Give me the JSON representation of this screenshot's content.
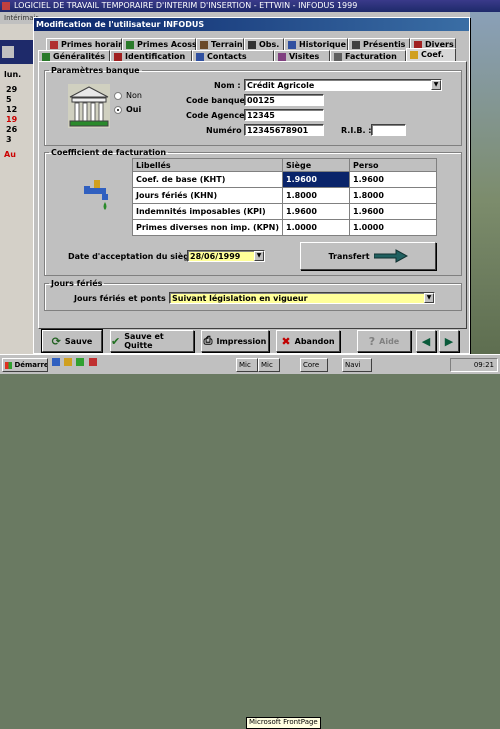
{
  "background_app": {
    "title": "LOGICIEL DE TRAVAIL TEMPORAIRE D'INTERIM D'INSERTION - ETTWIN - INFODUS 1999",
    "menu": "Intérimair",
    "calendar_header": "lun.",
    "calendar_days": [
      "29",
      "5",
      "12",
      "19",
      "26",
      "3"
    ],
    "calendar_footer": "Au"
  },
  "dialog": {
    "title": "Modification de l'utilisateur INFODUS",
    "tabs_row1": [
      "Primes horaires",
      "Primes Acoss",
      "Terrain",
      "Obs.",
      "Historique",
      "Présentis",
      "Divers"
    ],
    "tabs_row2": [
      "Généralités",
      "Identification",
      "Contacts",
      "Visites",
      "Facturation",
      "Coef."
    ],
    "active_tab": "Coef."
  },
  "banque": {
    "legend": "Paramètres banque",
    "radio_non": "Non",
    "radio_oui": "Oui",
    "nom_label": "Nom :",
    "nom_value": "Crédit Agricole",
    "code_banque_label": "Code banque :",
    "code_banque_value": "00125",
    "code_agence_label": "Code Agence :",
    "code_agence_value": "12345",
    "numero_label": "Numéro :",
    "numero_value": "12345678901",
    "rib_label": "R.I.B. :",
    "rib_value": ""
  },
  "facturation": {
    "legend": "Coefficient de facturation",
    "headers": [
      "Libellés",
      "Siège",
      "Perso"
    ],
    "rows": [
      {
        "label": "Coef. de base (KHT)",
        "siege": "1.9600",
        "perso": "1.9600"
      },
      {
        "label": "Jours fériés (KHN)",
        "siege": "1.8000",
        "perso": "1.8000"
      },
      {
        "label": "Indemnités imposables (KPI)",
        "siege": "1.9600",
        "perso": "1.9600"
      },
      {
        "label": "Primes diverses non imp. (KPN)",
        "siege": "1.0000",
        "perso": "1.0000"
      }
    ],
    "date_label": "Date d'acceptation du siège :",
    "date_value": "28/06/1999",
    "transfert_label": "Transfert"
  },
  "feries": {
    "legend": "Jours fériés",
    "label": "Jours fériés et ponts :",
    "value": "Suivant législation en vigueur"
  },
  "buttons": {
    "sauve": "Sauve",
    "sauve_quitte": "Sauve et Quitte",
    "impression": "Impression",
    "abandon": "Abandon",
    "aide": "Aide"
  },
  "taskbar": {
    "start": "Démarrer",
    "tasks": [
      "Mic",
      "Mic",
      "Core",
      "Navi"
    ],
    "tooltip": "Microsoft FrontPage",
    "clock": "09:21"
  },
  "colors": {
    "title_bar": "#0a246a",
    "selection": "#0a246a",
    "field_highlight": "#ffff99",
    "face": "#c0c0c0"
  }
}
